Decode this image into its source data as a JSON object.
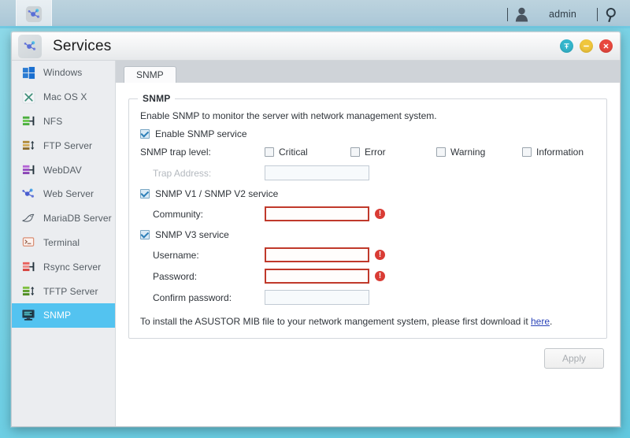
{
  "desktop": {
    "user_name": "admin",
    "user_icon": "user-icon",
    "search_icon": "search-icon",
    "app_launcher_icon": "services-app-icon"
  },
  "window": {
    "title": "Services",
    "app_icon": "services-app-icon",
    "buttons": {
      "pin_label": "⇱",
      "minimize_label": "–",
      "close_label": "✕"
    }
  },
  "sidebar": {
    "items": [
      {
        "label": "Windows",
        "icon": "windows-icon",
        "active": false
      },
      {
        "label": "Mac OS X",
        "icon": "macosx-icon",
        "active": false
      },
      {
        "label": "NFS",
        "icon": "nfs-icon",
        "active": false
      },
      {
        "label": "FTP Server",
        "icon": "ftp-icon",
        "active": false
      },
      {
        "label": "WebDAV",
        "icon": "webdav-icon",
        "active": false
      },
      {
        "label": "Web Server",
        "icon": "webserver-icon",
        "active": false
      },
      {
        "label": "MariaDB Server",
        "icon": "mariadb-icon",
        "active": false
      },
      {
        "label": "Terminal",
        "icon": "terminal-icon",
        "active": false
      },
      {
        "label": "Rsync Server",
        "icon": "rsync-icon",
        "active": false
      },
      {
        "label": "TFTP Server",
        "icon": "tftp-icon",
        "active": false
      },
      {
        "label": "SNMP",
        "icon": "snmp-icon",
        "active": true
      }
    ]
  },
  "main": {
    "tab_label": "SNMP",
    "fieldset_legend": "SNMP",
    "description": "Enable SNMP to monitor the server with network management system.",
    "enable_service": {
      "label": "Enable SNMP service",
      "checked": true
    },
    "trap_level": {
      "label": "SNMP trap level:",
      "options": [
        {
          "label": "Critical",
          "checked": false
        },
        {
          "label": "Error",
          "checked": false
        },
        {
          "label": "Warning",
          "checked": false
        },
        {
          "label": "Information",
          "checked": false
        }
      ]
    },
    "trap_address": {
      "label": "Trap Address:",
      "value": "",
      "disabled": true
    },
    "v1v2": {
      "label": "SNMP V1 / SNMP V2 service",
      "checked": true
    },
    "community": {
      "label": "Community:",
      "value": "",
      "error": true,
      "error_icon": "error-icon"
    },
    "v3": {
      "label": "SNMP V3 service",
      "checked": true
    },
    "username": {
      "label": "Username:",
      "value": "",
      "error": true,
      "error_icon": "error-icon"
    },
    "password": {
      "label": "Password:",
      "value": "",
      "error": true,
      "error_icon": "error-icon"
    },
    "confirm_password": {
      "label": "Confirm password:",
      "value": "",
      "error": false
    },
    "footnote": {
      "prefix": "To install the ASUSTOR MIB file to your network mangement system, please first download it ",
      "link": "here",
      "suffix": "."
    },
    "apply_label": "Apply"
  },
  "colors": {
    "accent": "#53c3f0",
    "desktop": "#6fcfe4",
    "error": "#c0392b",
    "link": "#2b44b8",
    "tabstrip": "#cfd3d8"
  }
}
